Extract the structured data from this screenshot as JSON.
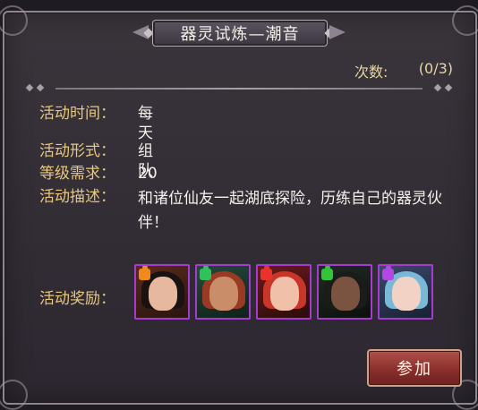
{
  "dialog": {
    "title": "器灵试炼—潮音",
    "count_label": "次数:",
    "count_value": "(0/3)"
  },
  "info": [
    {
      "label": "活动时间：",
      "value": "每天"
    },
    {
      "label": "活动形式：",
      "value": "组队"
    },
    {
      "label": "等级需求：",
      "value": "20"
    },
    {
      "label": "活动描述：",
      "value": "和诸位仙友一起湖底探险，历练自己的器灵伙伴！"
    }
  ],
  "rewards_label": "活动奖励：",
  "rewards": [
    {
      "icon": "spirit-fragment-orange-lady-icon",
      "puzzle_color": "#f08a1e",
      "frame_color": "#a63bd1"
    },
    {
      "icon": "spirit-fragment-green-warrior-icon",
      "puzzle_color": "#2fc25b",
      "frame_color": "#a63bd1"
    },
    {
      "icon": "spirit-fragment-red-hair-lady-icon",
      "puzzle_color": "#e8322a",
      "frame_color": "#a63bd1"
    },
    {
      "icon": "spirit-fragment-green-hooded-icon",
      "puzzle_color": "#34c43a",
      "frame_color": "#a63bd1"
    },
    {
      "icon": "spirit-fragment-purple-blue-lady-icon",
      "puzzle_color": "#b347e6",
      "frame_color": "#a63bd1"
    }
  ],
  "join_button": "参加",
  "colors": {
    "label": "#e8c77c",
    "value": "#f4f1ec",
    "count": "#e7d6a3",
    "button": "#8a2f2c"
  }
}
